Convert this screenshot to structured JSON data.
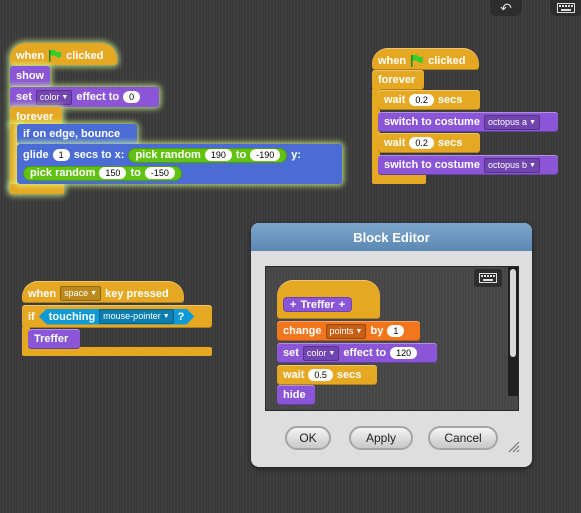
{
  "toolbar": {
    "undo_icon": "undo-arrow-icon",
    "keyboard_icon": "keyboard-icon"
  },
  "script1": {
    "hat": {
      "label_when": "when",
      "label_clicked": "clicked"
    },
    "show": "show",
    "set_effect": {
      "set": "set",
      "effect_dd": "color",
      "effect_label": "effect to",
      "value": "0"
    },
    "forever": "forever",
    "bounce": "if on edge, bounce",
    "glide": {
      "glide": "glide",
      "secs_value": "1",
      "secs_to_x": "secs to x:",
      "pick_random": "pick random",
      "x_from": "190",
      "to": "to",
      "x_to": "-190",
      "y": "y:",
      "y_from": "150",
      "y_to": "-150"
    }
  },
  "script2": {
    "hat": {
      "label_when": "when",
      "label_clicked": "clicked"
    },
    "forever": "forever",
    "wait1": {
      "wait": "wait",
      "value": "0.2",
      "secs": "secs"
    },
    "switch1": {
      "label": "switch to costume",
      "costume": "octopus a"
    },
    "wait2": {
      "wait": "wait",
      "value": "0.2",
      "secs": "secs"
    },
    "switch2": {
      "label": "switch to costume",
      "costume": "octopus b"
    }
  },
  "script3": {
    "hat": {
      "when": "when",
      "key": "space",
      "key_pressed": "key pressed"
    },
    "if": "if",
    "touching": {
      "label": "touching",
      "target": "mouse-pointer",
      "q": "?"
    },
    "custom": "Treffer"
  },
  "block_editor": {
    "title": "Block Editor",
    "prototype": "Treffer",
    "change": {
      "label": "change",
      "var": "points",
      "by": "by",
      "value": "1"
    },
    "set_effect": {
      "set": "set",
      "effect_dd": "color",
      "effect_label": "effect to",
      "value": "120"
    },
    "wait": {
      "wait": "wait",
      "value": "0.5",
      "secs": "secs"
    },
    "hide": "hide",
    "ok": "OK",
    "apply": "Apply",
    "cancel": "Cancel"
  }
}
